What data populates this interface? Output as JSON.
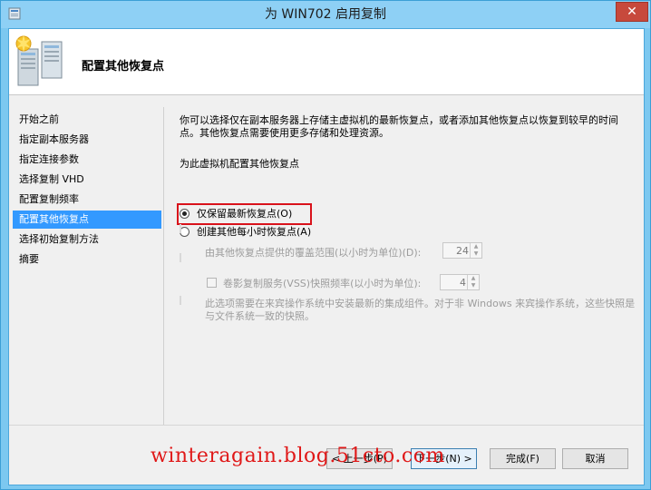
{
  "window": {
    "title": "为 WIN702 启用复制",
    "close_glyph": "✕"
  },
  "header": {
    "title": "配置其他恢复点"
  },
  "nav": {
    "items": [
      {
        "label": "开始之前",
        "active": false
      },
      {
        "label": "指定副本服务器",
        "active": false
      },
      {
        "label": "指定连接参数",
        "active": false
      },
      {
        "label": "选择复制 VHD",
        "active": false
      },
      {
        "label": "配置复制频率",
        "active": false
      },
      {
        "label": "配置其他恢复点",
        "active": true
      },
      {
        "label": "选择初始复制方法",
        "active": false
      },
      {
        "label": "摘要",
        "active": false
      }
    ]
  },
  "content": {
    "description": "你可以选择仅在副本服务器上存储主虚拟机的最新恢复点，或者添加其他恢复点以恢复到较早的时间点。其他恢复点需要使用更多存储和处理资源。",
    "group_label": "为此虚拟机配置其他恢复点",
    "option_latest": "仅保留最新恢复点(O)",
    "option_hourly": "创建其他每小时恢复点(A)",
    "coverage_label": "由其他恢复点提供的覆盖范围(以小时为单位)(D):",
    "coverage_value": "24",
    "vss_label": "卷影复制服务(VSS)快照频率(以小时为单位):",
    "vss_value": "4",
    "vss_note": "此选项需要在来宾操作系统中安装最新的集成组件。对于非 Windows 来宾操作系统，这些快照是与文件系统一致的快照。"
  },
  "footer": {
    "prev_label": "< 上一步(P)",
    "next_label": "下一步(N) >",
    "finish_label": "完成(F)",
    "cancel_label": "取消"
  },
  "watermark": "winteragain.blog.51cto.com"
}
